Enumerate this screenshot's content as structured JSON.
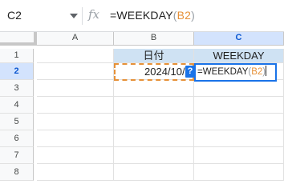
{
  "formula_bar": {
    "name_box": "C2",
    "fx_label": "fx",
    "formula_prefix": "=WEEKDAY",
    "formula_open": "(",
    "formula_ref": "B2",
    "formula_close": ")"
  },
  "columns": [
    {
      "label": "A",
      "selected": false
    },
    {
      "label": "B",
      "selected": false
    },
    {
      "label": "C",
      "selected": true
    }
  ],
  "rows": [
    "1",
    "2",
    "3",
    "4",
    "5",
    "6",
    "7",
    "8"
  ],
  "selected_row": "2",
  "cells": {
    "B1": "日付",
    "C1": "WEEKDAY",
    "B2": "2024/10/"
  },
  "editor": {
    "prefix": "=WEEKDAY",
    "open": "(",
    "ref": "B2",
    "close": ")"
  },
  "help_badge": "?",
  "colors": {
    "header_fill": "#cfe2f3",
    "selection_blue": "#1a73e8",
    "reference_orange": "#e69138"
  }
}
